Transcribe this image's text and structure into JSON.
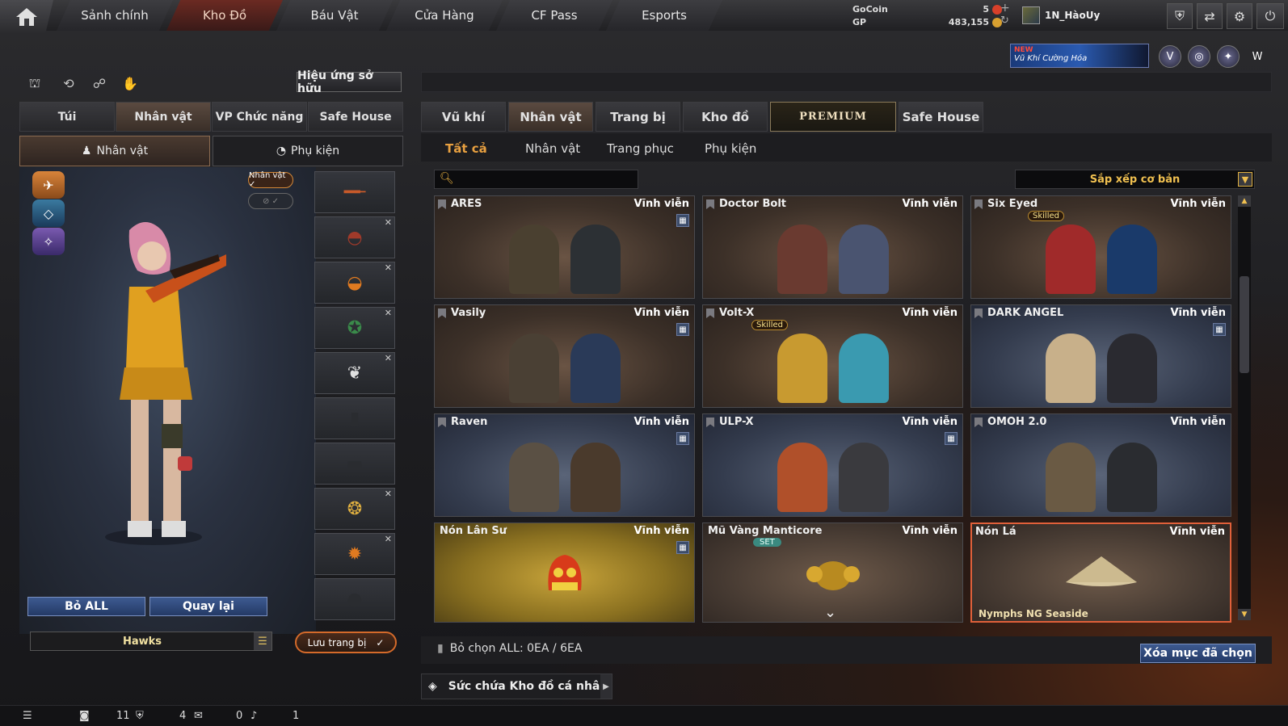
{
  "nav": {
    "tabs": [
      "Sảnh chính",
      "Kho Đồ",
      "Báu Vật",
      "Cửa Hàng",
      "CF Pass",
      "Esports"
    ],
    "active": "Kho Đồ"
  },
  "currency": {
    "gocoin_label": "GoCoin",
    "gocoin_value": "5",
    "gp_label": "GP",
    "gp_value": "483,155"
  },
  "user": {
    "name": "1N_HàoUy"
  },
  "banner": {
    "new": "NEW",
    "text": "Vũ Khí Cường Hóa"
  },
  "left": {
    "effect_button": "Hiệu ứng sở hữu",
    "tabs": [
      "Túi",
      "Nhân vật",
      "VP Chức năng",
      "Safe House"
    ],
    "subtabs": [
      "Nhân vật",
      "Phụ kiện"
    ],
    "badge": "Nhân vật ✓",
    "bo_all": "Bỏ ALL",
    "quay_lai": "Quay lại",
    "clan": "Hawks",
    "save": "Lưu trang bị"
  },
  "right": {
    "tabs": [
      "Vũ khí",
      "Nhân vật",
      "Trang bị",
      "Kho đồ",
      "PREMIUM",
      "Safe House"
    ],
    "subtabs": [
      "Tất cả",
      "Nhân vật",
      "Trang phục",
      "Phụ kiện"
    ],
    "sort": "Sắp xếp cơ bản",
    "items": [
      {
        "name": "ARES",
        "duration": "Vĩnh viễn"
      },
      {
        "name": "Doctor Bolt",
        "duration": "Vĩnh viễn"
      },
      {
        "name": "Six Eyed",
        "duration": "Vĩnh viễn",
        "tag": "Skilled"
      },
      {
        "name": "Vasily",
        "duration": "Vĩnh viễn"
      },
      {
        "name": "Volt-X",
        "duration": "Vĩnh viễn",
        "tag": "Skilled"
      },
      {
        "name": "DARK ANGEL",
        "duration": "Vĩnh viễn"
      },
      {
        "name": "Raven",
        "duration": "Vĩnh viễn"
      },
      {
        "name": "ULP-X",
        "duration": "Vĩnh viễn"
      },
      {
        "name": "OMOH 2.0",
        "duration": "Vĩnh viễn"
      },
      {
        "name": "Nón Lân Sư",
        "duration": "Vĩnh viễn"
      },
      {
        "name": "Mũ Vàng Manticore",
        "duration": "Vĩnh viễn",
        "tag": "SET"
      },
      {
        "name": "Nón Lá",
        "duration": "Vĩnh viễn",
        "footer": "Nymphs NG Seaside"
      }
    ],
    "deselect": "Bỏ chọn ALL: 0EA / 6EA",
    "delete": "Xóa mục đã chọn",
    "storage": "Sức chứa Kho đồ cá nhân"
  },
  "status": {
    "friends": "11",
    "clan": "4",
    "chat": "0",
    "voice": "1"
  }
}
